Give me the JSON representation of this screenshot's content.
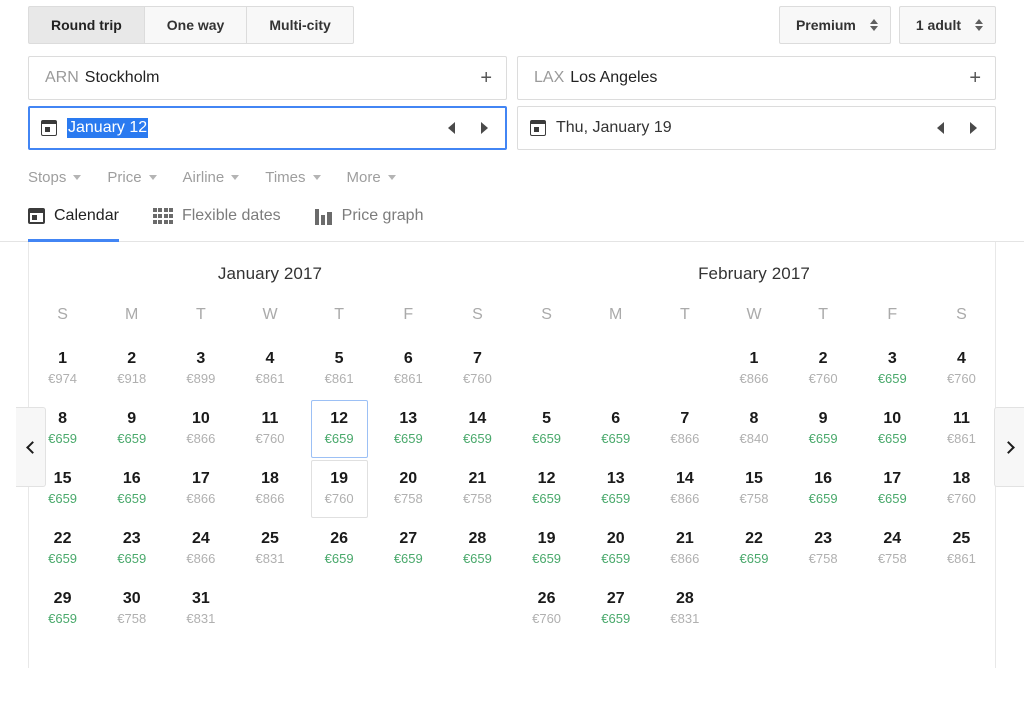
{
  "trip_types": [
    {
      "label": "Round trip",
      "active": true
    },
    {
      "label": "One way",
      "active": false
    },
    {
      "label": "Multi-city",
      "active": false
    }
  ],
  "cabin": {
    "label": "Premium"
  },
  "passengers": {
    "label": "1 adult"
  },
  "origin": {
    "code": "ARN",
    "city": "Stockholm",
    "add_label": "+"
  },
  "destination": {
    "code": "LAX",
    "city": "Los Angeles",
    "add_label": "+"
  },
  "depart_date": {
    "value": "January 12",
    "selected": true
  },
  "return_date": {
    "value": "Thu, January 19",
    "selected": false
  },
  "filters": [
    {
      "label": "Stops"
    },
    {
      "label": "Price"
    },
    {
      "label": "Airline"
    },
    {
      "label": "Times"
    },
    {
      "label": "More"
    }
  ],
  "tabs": [
    {
      "label": "Calendar",
      "icon": "calendar-icon",
      "active": true
    },
    {
      "label": "Flexible dates",
      "icon": "grid-icon",
      "active": false
    },
    {
      "label": "Price graph",
      "icon": "bar-chart-icon",
      "active": false
    }
  ],
  "nav": {
    "prev": "chevron-left-icon",
    "next": "chevron-right-icon"
  },
  "weekday_labels": [
    "S",
    "M",
    "T",
    "W",
    "T",
    "F",
    "S"
  ],
  "colors": {
    "accent": "#4285f4",
    "cheap_price": "#4aa96c",
    "normal_price": "#b0b0b0",
    "selection_highlight": "#2a7af0"
  },
  "months": [
    {
      "title": "January 2017",
      "lead_blanks": 0,
      "days": [
        {
          "day": "1",
          "price": "€974",
          "cheap": false
        },
        {
          "day": "2",
          "price": "€918",
          "cheap": false
        },
        {
          "day": "3",
          "price": "€899",
          "cheap": false
        },
        {
          "day": "4",
          "price": "€861",
          "cheap": false
        },
        {
          "day": "5",
          "price": "€861",
          "cheap": false
        },
        {
          "day": "6",
          "price": "€861",
          "cheap": false
        },
        {
          "day": "7",
          "price": "€760",
          "cheap": false
        },
        {
          "day": "8",
          "price": "€659",
          "cheap": true
        },
        {
          "day": "9",
          "price": "€659",
          "cheap": true
        },
        {
          "day": "10",
          "price": "€866",
          "cheap": false
        },
        {
          "day": "11",
          "price": "€760",
          "cheap": false
        },
        {
          "day": "12",
          "price": "€659",
          "cheap": true,
          "state": "start"
        },
        {
          "day": "13",
          "price": "€659",
          "cheap": true
        },
        {
          "day": "14",
          "price": "€659",
          "cheap": true
        },
        {
          "day": "15",
          "price": "€659",
          "cheap": true
        },
        {
          "day": "16",
          "price": "€659",
          "cheap": true
        },
        {
          "day": "17",
          "price": "€866",
          "cheap": false
        },
        {
          "day": "18",
          "price": "€866",
          "cheap": false
        },
        {
          "day": "19",
          "price": "€760",
          "cheap": false,
          "state": "end"
        },
        {
          "day": "20",
          "price": "€758",
          "cheap": false
        },
        {
          "day": "21",
          "price": "€758",
          "cheap": false
        },
        {
          "day": "22",
          "price": "€659",
          "cheap": true
        },
        {
          "day": "23",
          "price": "€659",
          "cheap": true
        },
        {
          "day": "24",
          "price": "€866",
          "cheap": false
        },
        {
          "day": "25",
          "price": "€831",
          "cheap": false
        },
        {
          "day": "26",
          "price": "€659",
          "cheap": true
        },
        {
          "day": "27",
          "price": "€659",
          "cheap": true
        },
        {
          "day": "28",
          "price": "€659",
          "cheap": true
        },
        {
          "day": "29",
          "price": "€659",
          "cheap": true
        },
        {
          "day": "30",
          "price": "€758",
          "cheap": false
        },
        {
          "day": "31",
          "price": "€831",
          "cheap": false
        }
      ]
    },
    {
      "title": "February 2017",
      "lead_blanks": 3,
      "days": [
        {
          "day": "1",
          "price": "€866",
          "cheap": false
        },
        {
          "day": "2",
          "price": "€760",
          "cheap": false
        },
        {
          "day": "3",
          "price": "€659",
          "cheap": true
        },
        {
          "day": "4",
          "price": "€760",
          "cheap": false
        },
        {
          "day": "5",
          "price": "€659",
          "cheap": true
        },
        {
          "day": "6",
          "price": "€659",
          "cheap": true
        },
        {
          "day": "7",
          "price": "€866",
          "cheap": false
        },
        {
          "day": "8",
          "price": "€840",
          "cheap": false
        },
        {
          "day": "9",
          "price": "€659",
          "cheap": true
        },
        {
          "day": "10",
          "price": "€659",
          "cheap": true
        },
        {
          "day": "11",
          "price": "€861",
          "cheap": false
        },
        {
          "day": "12",
          "price": "€659",
          "cheap": true
        },
        {
          "day": "13",
          "price": "€659",
          "cheap": true
        },
        {
          "day": "14",
          "price": "€866",
          "cheap": false
        },
        {
          "day": "15",
          "price": "€758",
          "cheap": false
        },
        {
          "day": "16",
          "price": "€659",
          "cheap": true
        },
        {
          "day": "17",
          "price": "€659",
          "cheap": true
        },
        {
          "day": "18",
          "price": "€760",
          "cheap": false
        },
        {
          "day": "19",
          "price": "€659",
          "cheap": true
        },
        {
          "day": "20",
          "price": "€659",
          "cheap": true
        },
        {
          "day": "21",
          "price": "€866",
          "cheap": false
        },
        {
          "day": "22",
          "price": "€659",
          "cheap": true
        },
        {
          "day": "23",
          "price": "€758",
          "cheap": false
        },
        {
          "day": "24",
          "price": "€758",
          "cheap": false
        },
        {
          "day": "25",
          "price": "€861",
          "cheap": false
        },
        {
          "day": "26",
          "price": "€760",
          "cheap": false
        },
        {
          "day": "27",
          "price": "€659",
          "cheap": true
        },
        {
          "day": "28",
          "price": "€831",
          "cheap": false
        }
      ]
    }
  ]
}
